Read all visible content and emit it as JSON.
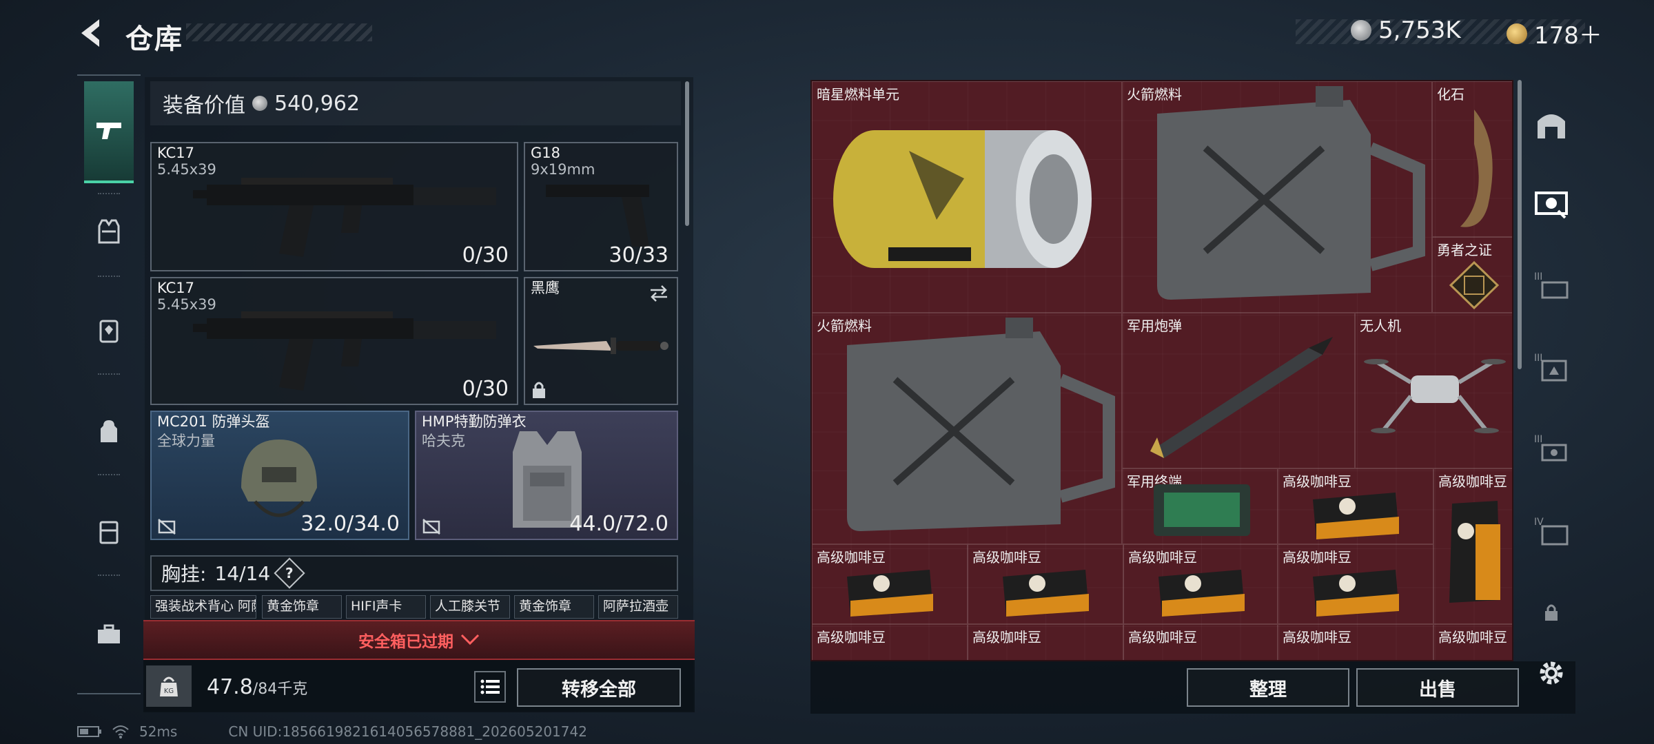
{
  "header": {
    "title": "仓库",
    "currency_silver": "5,753K",
    "currency_gold": "178＋"
  },
  "nav": {
    "items": [
      "pistol-icon",
      "armor-vest-icon",
      "backpack-rig-icon",
      "backpack-icon",
      "case-icon",
      "toolbox-icon"
    ]
  },
  "left": {
    "equip_value_label": "装备价值",
    "equip_value": "540,962",
    "weapons": [
      {
        "name": "KC17",
        "sub": "5.45x39",
        "count": "0/30"
      },
      {
        "name": "G18",
        "sub": "9x19mm",
        "count": "30/33"
      },
      {
        "name": "KC17",
        "sub": "5.45x39",
        "count": "0/30"
      },
      {
        "name": "黑鹰",
        "sub": "",
        "count": ""
      }
    ],
    "helmet": {
      "name": "MC201 防弹头盔",
      "sub": "全球力量",
      "count": "32.0/34.0"
    },
    "vest": {
      "name": "HMP特勤防弹衣",
      "sub": "哈夫克",
      "count": "44.0/72.0"
    },
    "chest_label": "胸挂:",
    "chest_count": "14/14",
    "chest_help": "?",
    "slots": [
      "强装战术背心 阿萨拉...",
      "黄金饰章",
      "HIFI声卡",
      "人工膝关节",
      "黄金饰章",
      "阿萨拉酒壶"
    ],
    "expired": "安全箱已过期",
    "weight": "47.8",
    "weight_max": "/84千克",
    "transfer_all": "转移全部"
  },
  "stash": {
    "items": [
      {
        "label": "暗星燃料单元"
      },
      {
        "label": "火箭燃料"
      },
      {
        "label": "化石"
      },
      {
        "label": "勇者之证"
      },
      {
        "label": "火箭燃料"
      },
      {
        "label": "军用炮弹"
      },
      {
        "label": "无人机"
      },
      {
        "label": "军用终端"
      },
      {
        "label": "高级咖啡豆"
      },
      {
        "label": "高级咖啡豆"
      },
      {
        "label": "高级咖啡豆"
      },
      {
        "label": "高级咖啡豆"
      },
      {
        "label": "高级咖啡豆"
      },
      {
        "label": "高级咖啡豆"
      },
      {
        "label": "高级咖啡豆"
      },
      {
        "label": "高级咖啡豆"
      },
      {
        "label": "高级咖啡豆"
      },
      {
        "label": "高级咖啡豆"
      },
      {
        "label": "高级咖啡豆"
      }
    ],
    "sort": "整理",
    "sell": "出售"
  },
  "status": {
    "ping": "52ms",
    "uid": "CN UID:1856619821614056578881_202605201742"
  },
  "colors": {
    "accent": "#4ad1a6",
    "stash_bg": "#4a1c22",
    "alert": "#ff5f5f"
  }
}
